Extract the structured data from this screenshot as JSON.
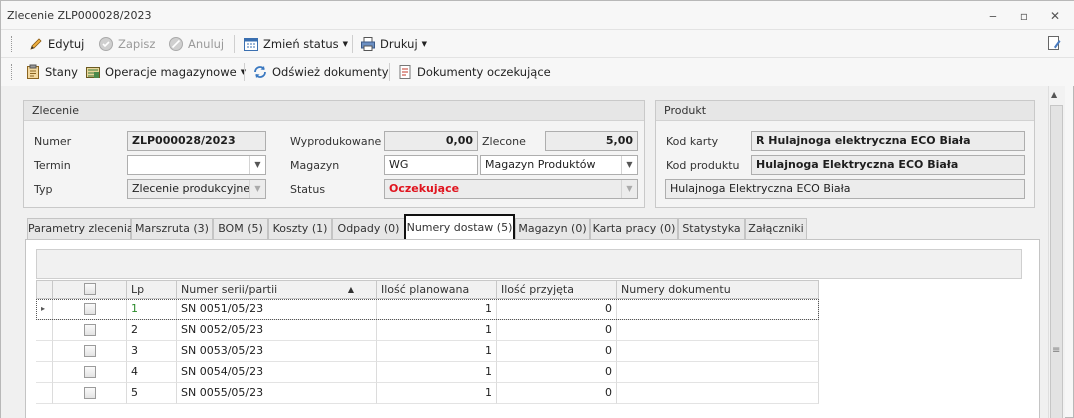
{
  "window": {
    "title": "Zlecenie ZLP000028/2023"
  },
  "toolbar1": {
    "edit": "Edytuj",
    "save": "Zapisz",
    "cancel": "Anuluj",
    "change_status": "Zmień status",
    "print": "Drukuj"
  },
  "toolbar2": {
    "states": "Stany",
    "warehouse_ops": "Operacje magazynowe",
    "refresh_docs": "Odśwież dokumenty",
    "pending_docs": "Dokumenty oczekujące"
  },
  "order_group": {
    "header": "Zlecenie",
    "number_label": "Numer",
    "number_value": "ZLP000028/2023",
    "term_label": "Termin",
    "term_value": "",
    "type_label": "Typ",
    "type_value": "Zlecenie produkcyjne",
    "produced_label": "Wyprodukowane",
    "produced_value": "0,00",
    "ordered_label": "Zlecone",
    "ordered_value": "5,00",
    "warehouse_label": "Magazyn",
    "warehouse_code": "WG",
    "warehouse_name": "Magazyn Produktów",
    "status_label": "Status",
    "status_value": "Oczekujące",
    "status_color": "#e0141e"
  },
  "product_group": {
    "header": "Produkt",
    "card_code_label": "Kod karty",
    "card_code_value": "R Hulajnoga elektryczna ECO Biała",
    "product_code_label": "Kod produktu",
    "product_code_value": "Hulajnoga Elektryczna ECO Biała",
    "description_value": "Hulajnoga Elektryczna ECO Biała"
  },
  "tabs": [
    "Parametry zlecenia",
    "Marszruta (3)",
    "BOM (5)",
    "Koszty (1)",
    "Odpady (0)",
    "Numery dostaw (5)",
    "Magazyn (0)",
    "Karta pracy (0)",
    "Statystyka",
    "Załączniki"
  ],
  "active_tab": "Numery dostaw (5)",
  "grid": {
    "columns": [
      "Lp",
      "Numer serii/partii",
      "Ilość planowana",
      "Ilość przyjęta",
      "Numery dokumentu"
    ],
    "sort_indicator": "▲",
    "rows": [
      {
        "lp": "1",
        "serial": "SN 0051/05/23",
        "planned": "1",
        "received": "0",
        "docs": ""
      },
      {
        "lp": "2",
        "serial": "SN 0052/05/23",
        "planned": "1",
        "received": "0",
        "docs": ""
      },
      {
        "lp": "3",
        "serial": "SN 0053/05/23",
        "planned": "1",
        "received": "0",
        "docs": ""
      },
      {
        "lp": "4",
        "serial": "SN 0054/05/23",
        "planned": "1",
        "received": "0",
        "docs": ""
      },
      {
        "lp": "5",
        "serial": "SN 0055/05/23",
        "planned": "1",
        "received": "0",
        "docs": ""
      }
    ]
  },
  "icons": {
    "edit": "pencil-icon",
    "save": "save-disabled-icon",
    "cancel": "cancel-disabled-icon",
    "change_status": "calendar-icon",
    "print": "printer-icon",
    "states": "clipboard-icon",
    "warehouse_ops": "warehouse-icon",
    "refresh": "refresh-icon",
    "pending": "document-icon",
    "help": "help-doc-icon"
  }
}
